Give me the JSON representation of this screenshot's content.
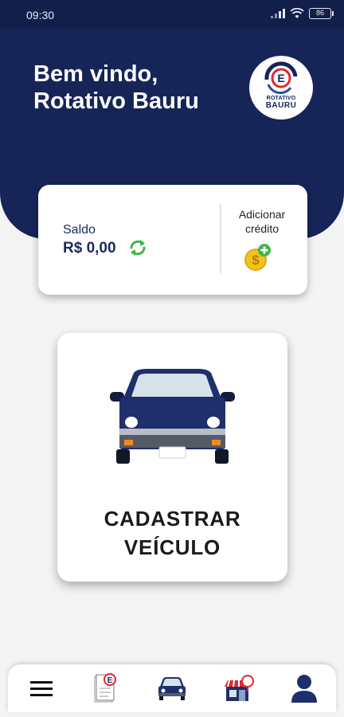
{
  "status_bar": {
    "time": "09:30",
    "battery": "86"
  },
  "header": {
    "welcome_line1": "Bem vindo,",
    "welcome_line2": "Rotativo Bauru",
    "logo_letter": "E",
    "logo_text_top": "ROTATIVO",
    "logo_text_bottom": "BAURU"
  },
  "balance": {
    "label": "Saldo",
    "value": "R$ 0,00",
    "add_credit_label": "Adicionar\ncrédito"
  },
  "vehicle_card": {
    "label": "CADASTRAR\nVEÍCULO"
  },
  "bottom_nav": {
    "items": [
      "menu-icon",
      "ticket-icon",
      "car-icon",
      "store-icon",
      "profile-icon"
    ]
  },
  "colors": {
    "primary": "#162458",
    "status_bar": "#131f4b",
    "accent_green": "#3fb54a",
    "accent_red": "#e0282e",
    "coin": "#f3c31c"
  }
}
